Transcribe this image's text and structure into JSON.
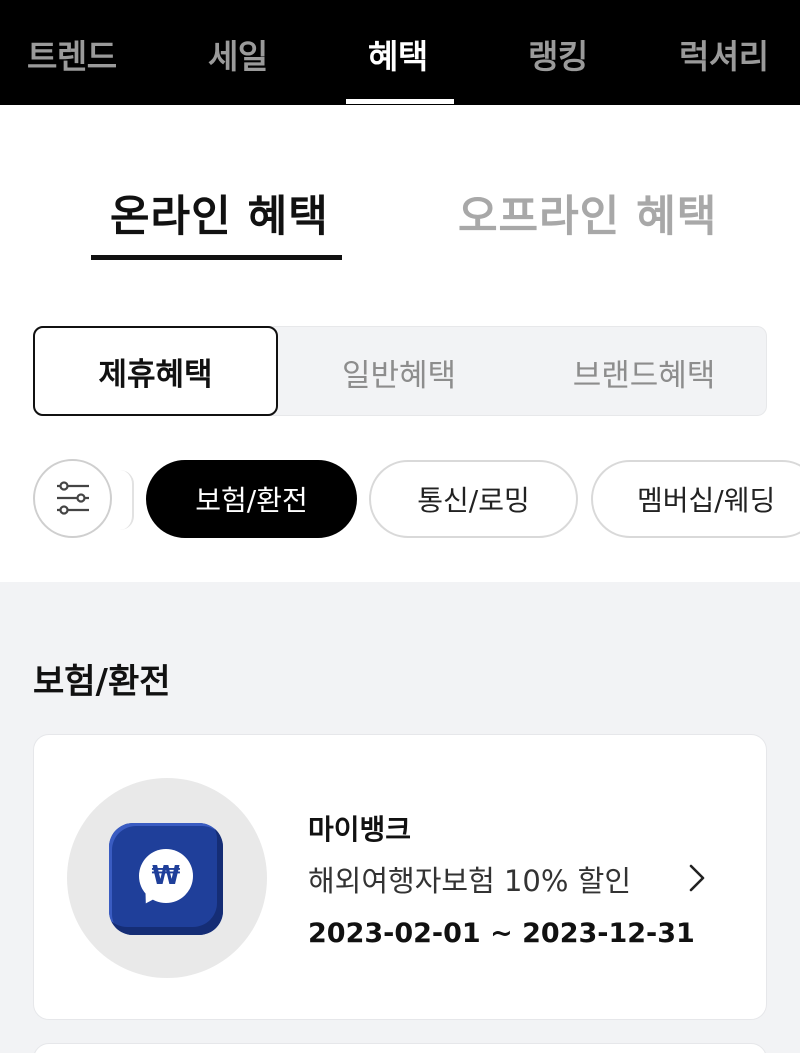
{
  "topnav": {
    "tabs": [
      {
        "label": "트렌드",
        "active": false
      },
      {
        "label": "세일",
        "active": false
      },
      {
        "label": "혜택",
        "active": true
      },
      {
        "label": "랭킹",
        "active": false
      },
      {
        "label": "럭셔리",
        "active": false
      }
    ]
  },
  "mode_tabs": {
    "online": "온라인 혜택",
    "offline": "오프라인 혜택",
    "active": "online"
  },
  "segments": {
    "items": [
      "제휴혜택",
      "일반혜택",
      "브랜드혜택"
    ],
    "active_index": 0
  },
  "chips": {
    "filter_icon": "sliders-icon",
    "items": [
      "보험/환전",
      "통신/로밍",
      "멤버십/웨딩"
    ],
    "active_index": 0
  },
  "section": {
    "title": "보험/환전",
    "cards": [
      {
        "name": "마이뱅크",
        "description": "해외여행자보험 10% 할인",
        "period": "2023-02-01 ~ 2023-12-31",
        "logo_symbol": "₩",
        "logo_icon": "won-chat-bubble-icon",
        "arrow_icon": "chevron-right-icon"
      }
    ]
  },
  "colors": {
    "nav_bg": "#000000",
    "page_bg": "#f2f3f5",
    "logo_blue": "#1f3f9a"
  }
}
